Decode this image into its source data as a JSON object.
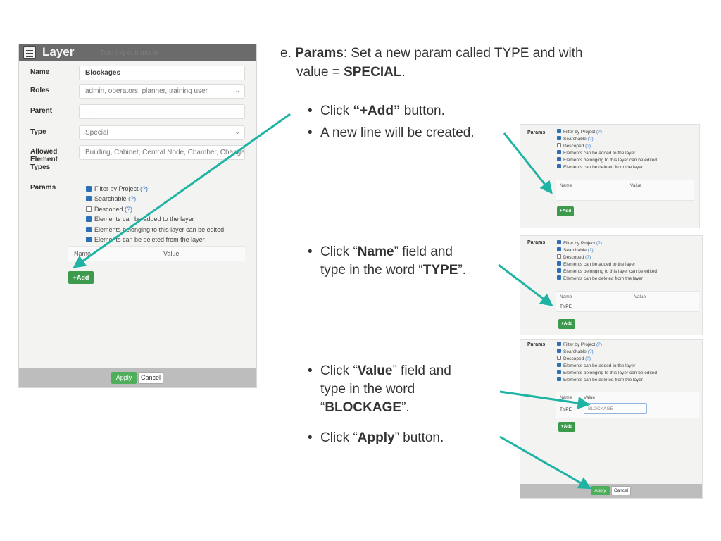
{
  "dialog": {
    "title": "Layer",
    "ghost_text": "Training      edit mode",
    "fields": [
      {
        "label": "Name",
        "value": ""
      },
      {
        "label": "Roles",
        "value": "admin, operators, planner, training user"
      },
      {
        "label": "Parent",
        "value": "..."
      },
      {
        "label": "Type",
        "value": "Special"
      },
      {
        "label": "Allowed Element Types",
        "value": "Building, Cabinet, Central Node, Chamber, Change of State, Clie..."
      }
    ],
    "name_value": "Blockages",
    "params_label": "Params",
    "params": [
      {
        "text": "Filter by Project",
        "help": "(?)",
        "checked": true
      },
      {
        "text": "Searchable",
        "help": "(?)",
        "checked": true
      },
      {
        "text": "Descoped",
        "help": "(?)",
        "checked": false
      },
      {
        "text": "Elements can be added to the layer",
        "help": "",
        "checked": true
      },
      {
        "text": "Elements belonging to this layer can be edited",
        "help": "",
        "checked": true
      },
      {
        "text": "Elements can be deleted from the layer",
        "help": "",
        "checked": true
      }
    ],
    "table_name_header": "Name",
    "table_value_header": "Value",
    "add_label": "+Add",
    "apply_label": "Apply",
    "cancel_label": "Cancel"
  },
  "instructions": {
    "step_letter": "e.",
    "step_title": "Params",
    "step_text_1": ": Set a new param called TYPE and with",
    "step_text_2": "value = ",
    "step_value": "SPECIAL",
    "step_end": ".",
    "bullets": {
      "b1_pre": "Click ",
      "b1_bold": "“+Add”",
      "b1_post": " button.",
      "b2": "A new line will be created.",
      "b3_l1_pre": "Click “",
      "b3_l1_bold": "Name",
      "b3_l1_post": "” field and",
      "b3_l2_pre": "type in the word “",
      "b3_l2_bold": "TYPE",
      "b3_l2_post": "”.",
      "b4_l1_pre": "Click “",
      "b4_l1_bold": "Value",
      "b4_l1_post": "” field and",
      "b4_l2": "type in the word",
      "b4_l3_pre": "“",
      "b4_l3_bold": "BLOCKAGE",
      "b4_l3_post": "”.",
      "b5_pre": "Click “",
      "b5_bold": "Apply",
      "b5_post": "” button."
    }
  },
  "thumb2": {
    "row_name": "TYPE"
  },
  "thumb3": {
    "row_name": "TYPE",
    "row_value": "BLOCKAGE"
  },
  "colors": {
    "accent_arrow": "#1fb3a4",
    "add_button": "#3d9a4d",
    "apply_button": "#4fae59",
    "checkbox": "#2c6fb6"
  },
  "bullet_glyph": "•"
}
